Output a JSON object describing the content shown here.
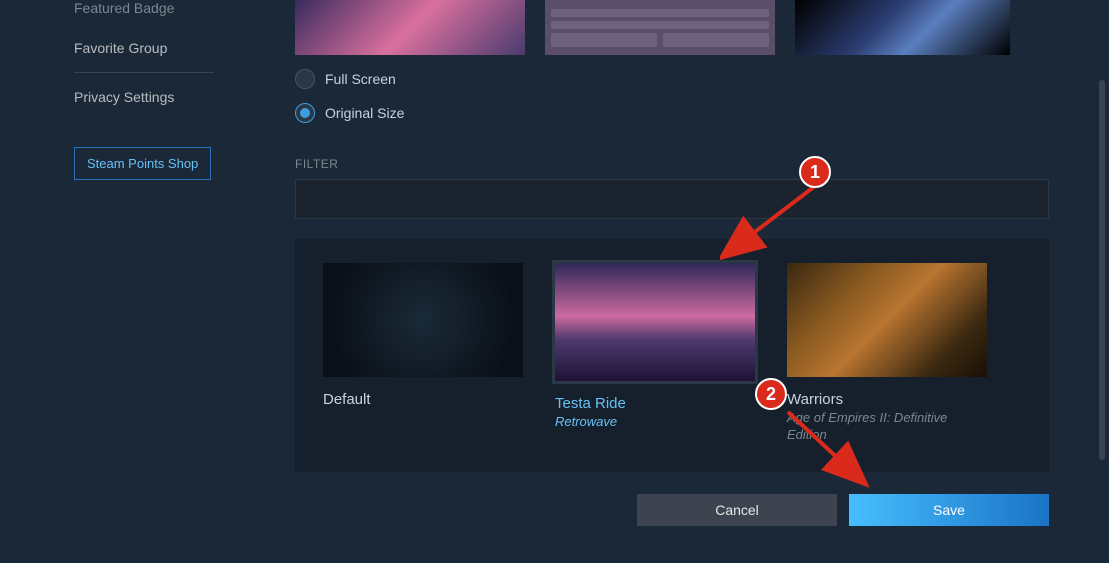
{
  "sidebar": {
    "items": [
      {
        "label": "Featured Badge"
      },
      {
        "label": "Favorite Group"
      },
      {
        "label": "Privacy Settings"
      }
    ],
    "points_shop": "Steam Points Shop"
  },
  "display_mode": {
    "full_screen": {
      "label": "Full Screen",
      "selected": false
    },
    "original_size": {
      "label": "Original Size",
      "selected": true
    }
  },
  "filter": {
    "label": "FILTER",
    "value": ""
  },
  "backgrounds": [
    {
      "title": "Default",
      "subtitle": "",
      "selected": false
    },
    {
      "title": "Testa Ride",
      "subtitle": "Retrowave",
      "selected": true
    },
    {
      "title": "Warriors",
      "subtitle": "Age of Empires II: Definitive Edition",
      "selected": false
    }
  ],
  "actions": {
    "cancel": "Cancel",
    "save": "Save"
  },
  "annotations": {
    "badge1": "1",
    "badge2": "2"
  }
}
